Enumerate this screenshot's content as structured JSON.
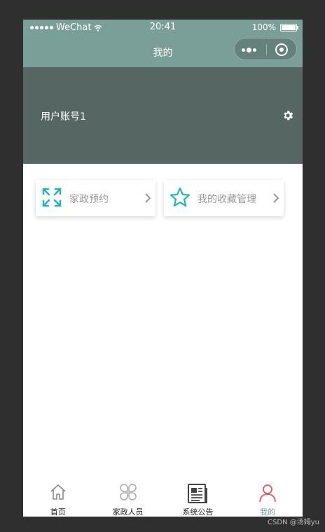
{
  "status_bar": {
    "carrier": "WeChat",
    "time": "20:41",
    "battery": "100%",
    "battery_level": 1.0
  },
  "navbar": {
    "title": "我的",
    "menu_icon": "more-dots-icon",
    "close_icon": "target-close-icon"
  },
  "profile": {
    "username": "用户账号1",
    "settings_icon": "gear-icon"
  },
  "cards": [
    {
      "label": "家政预约",
      "icon": "expand-icon"
    },
    {
      "label": "我的收藏管理",
      "icon": "star-icon"
    }
  ],
  "tabbar": {
    "items": [
      {
        "label": "首页",
        "icon": "home-icon"
      },
      {
        "label": "家政人员",
        "icon": "clover-icon"
      },
      {
        "label": "系统公告",
        "icon": "newspaper-icon"
      },
      {
        "label": "我的",
        "icon": "user-icon"
      }
    ],
    "active_index": 3
  },
  "watermark": "CSDN @汤姆yu",
  "colors": {
    "accent": "#7a9e98",
    "header": "#566662",
    "icon_teal": "#1fb6b6",
    "active_icon": "#e05a5a"
  }
}
